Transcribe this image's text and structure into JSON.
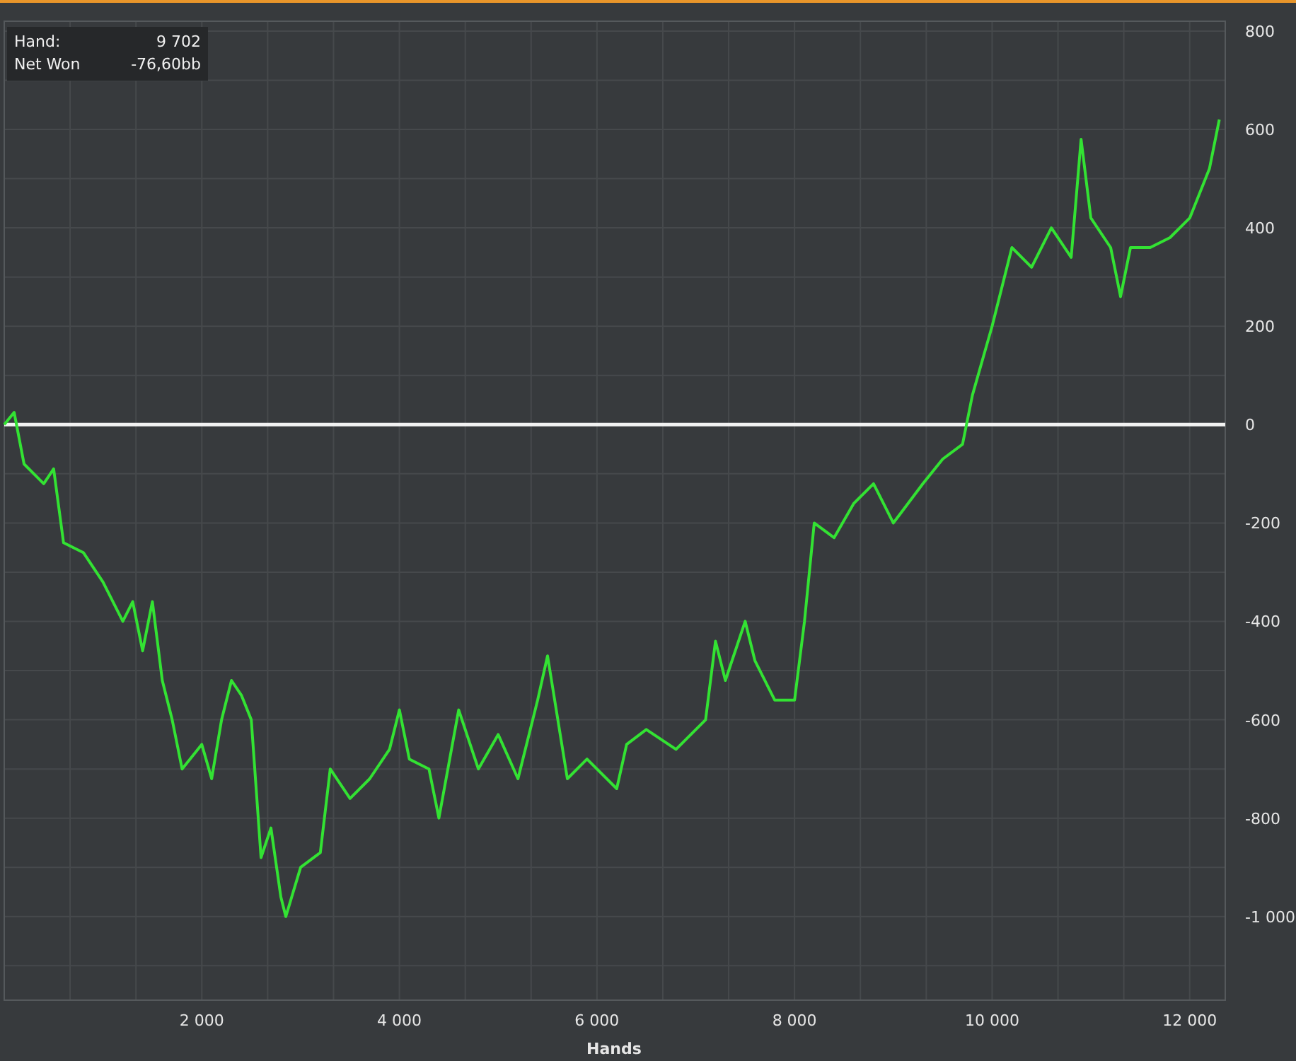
{
  "tooltip": {
    "rows": [
      {
        "label": "Hand:",
        "value": "9 702"
      },
      {
        "label": "Net Won",
        "value": "-76,60bb"
      }
    ]
  },
  "chart_data": {
    "type": "line",
    "xlabel": "Hands",
    "xlim": [
      0,
      12360
    ],
    "ylim": [
      -1170,
      820
    ],
    "xticks": [
      {
        "value": 2000,
        "label": "2 000"
      },
      {
        "value": 4000,
        "label": "4 000"
      },
      {
        "value": 6000,
        "label": "6 000"
      },
      {
        "value": 8000,
        "label": "8 000"
      },
      {
        "value": 10000,
        "label": "10 000"
      },
      {
        "value": 12000,
        "label": "12 000"
      }
    ],
    "yticks": [
      800,
      600,
      400,
      200,
      0,
      -200,
      -400,
      -600,
      -800,
      {
        "value": -1000,
        "label": "-1 000"
      }
    ],
    "x": [
      0,
      100,
      200,
      400,
      500,
      600,
      800,
      1000,
      1200,
      1300,
      1400,
      1500,
      1600,
      1700,
      1800,
      2000,
      2100,
      2200,
      2300,
      2400,
      2500,
      2600,
      2700,
      2800,
      2850,
      3000,
      3200,
      3300,
      3500,
      3700,
      3900,
      4000,
      4100,
      4300,
      4400,
      4600,
      4800,
      5000,
      5200,
      5400,
      5500,
      5700,
      5900,
      6000,
      6200,
      6300,
      6500,
      6800,
      7100,
      7200,
      7300,
      7500,
      7600,
      7800,
      8000,
      8100,
      8200,
      8400,
      8600,
      8800,
      9000,
      9300,
      9500,
      9700,
      9800,
      10000,
      10200,
      10400,
      10600,
      10800,
      10900,
      11000,
      11200,
      11300,
      11400,
      11600,
      11800,
      12000,
      12200,
      12300
    ],
    "series": [
      {
        "color": "#33e233",
        "values": [
          0,
          25,
          -80,
          -120,
          -90,
          -240,
          -260,
          -320,
          -400,
          -360,
          -460,
          -360,
          -520,
          -600,
          -700,
          -650,
          -720,
          -600,
          -520,
          -550,
          -600,
          -880,
          -820,
          -960,
          -1000,
          -900,
          -870,
          -700,
          -760,
          -720,
          -660,
          -580,
          -680,
          -700,
          -800,
          -580,
          -700,
          -630,
          -720,
          -560,
          -470,
          -720,
          -680,
          -700,
          -740,
          -650,
          -620,
          -660,
          -600,
          -440,
          -520,
          -400,
          -480,
          -560,
          -560,
          -400,
          -200,
          -230,
          -160,
          -120,
          -200,
          -120,
          -70,
          -40,
          60,
          200,
          360,
          320,
          400,
          340,
          580,
          420,
          360,
          260,
          360,
          360,
          380,
          420,
          520,
          620
        ]
      }
    ],
    "grid": true,
    "ref_lines": [
      {
        "axis": "y",
        "value": 0
      }
    ]
  }
}
